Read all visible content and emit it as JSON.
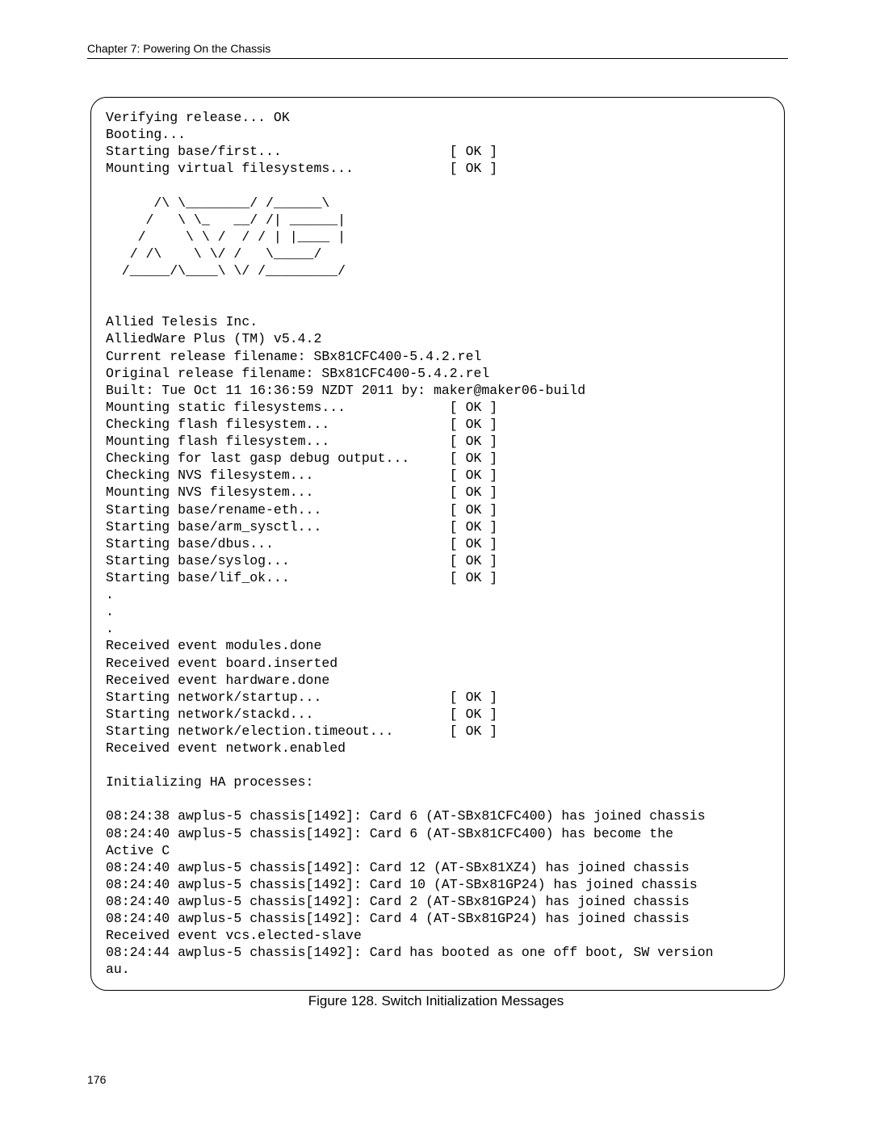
{
  "header": {
    "chapter_title": "Chapter 7: Powering On the Chassis"
  },
  "terminal": {
    "lines": [
      "Verifying release... OK",
      "Booting...",
      "Starting base/first...                     [ OK ]",
      "Mounting virtual filesystems...            [ OK ]",
      "",
      "      /\\ \\________/ /______\\",
      "     /   \\ \\_   __/ /| ______|",
      "    /     \\ \\ /  / / | |____ |",
      "   / /\\    \\ \\/ /   \\_____/",
      "  /_____/\\____\\ \\/ /_________/",
      "",
      "",
      "Allied Telesis Inc.",
      "AlliedWare Plus (TM) v5.4.2",
      "Current release filename: SBx81CFC400-5.4.2.rel",
      "Original release filename: SBx81CFC400-5.4.2.rel",
      "Built: Tue Oct 11 16:36:59 NZDT 2011 by: maker@maker06-build",
      "Mounting static filesystems...             [ OK ]",
      "Checking flash filesystem...               [ OK ]",
      "Mounting flash filesystem...               [ OK ]",
      "Checking for last gasp debug output...     [ OK ]",
      "Checking NVS filesystem...                 [ OK ]",
      "Mounting NVS filesystem...                 [ OK ]",
      "Starting base/rename-eth...                [ OK ]",
      "Starting base/arm_sysctl...                [ OK ]",
      "Starting base/dbus...                      [ OK ]",
      "Starting base/syslog...                    [ OK ]",
      "Starting base/lif_ok...                    [ OK ]",
      ".",
      ".",
      ".",
      "Received event modules.done",
      "Received event board.inserted",
      "Received event hardware.done",
      "Starting network/startup...                [ OK ]",
      "Starting network/stackd...                 [ OK ]",
      "Starting network/election.timeout...       [ OK ]",
      "Received event network.enabled",
      "",
      "Initializing HA processes:",
      "",
      "08:24:38 awplus-5 chassis[1492]: Card 6 (AT-SBx81CFC400) has joined chassis",
      "08:24:40 awplus-5 chassis[1492]: Card 6 (AT-SBx81CFC400) has become the ",
      "Active C",
      "08:24:40 awplus-5 chassis[1492]: Card 12 (AT-SBx81XZ4) has joined chassis",
      "08:24:40 awplus-5 chassis[1492]: Card 10 (AT-SBx81GP24) has joined chassis",
      "08:24:40 awplus-5 chassis[1492]: Card 2 (AT-SBx81GP24) has joined chassis",
      "08:24:40 awplus-5 chassis[1492]: Card 4 (AT-SBx81GP24) has joined chassis",
      "Received event vcs.elected-slave",
      "08:24:44 awplus-5 chassis[1492]: Card has booted as one off boot, SW version ",
      "au."
    ]
  },
  "figure": {
    "caption": "Figure 128. Switch Initialization Messages"
  },
  "footer": {
    "page_number": "176"
  }
}
